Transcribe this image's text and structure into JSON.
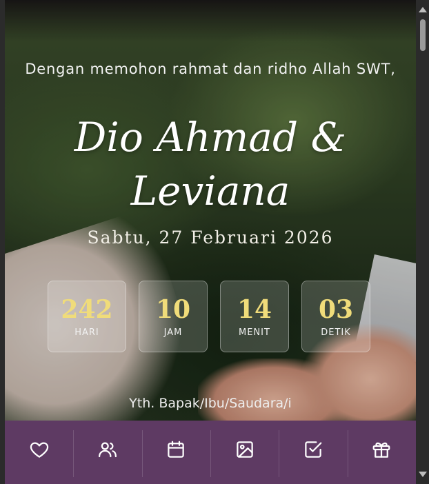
{
  "hero": {
    "intro": "Dengan memohon rahmat dan ridho Allah SWT,",
    "names_line1": "Dio Ahmad &",
    "names_line2": "Leviana",
    "date": "Sabtu, 27 Februari 2026"
  },
  "countdown": [
    {
      "value": "242",
      "unit": "HARI"
    },
    {
      "value": "10",
      "unit": "JAM"
    },
    {
      "value": "14",
      "unit": "MENIT"
    },
    {
      "value": "03",
      "unit": "DETIK"
    }
  ],
  "guest": {
    "greeting": "Yth. Bapak/Ibu/Saudara/i"
  },
  "nav": {
    "items": [
      {
        "icon": "heart-icon"
      },
      {
        "icon": "users-icon"
      },
      {
        "icon": "calendar-icon"
      },
      {
        "icon": "image-icon"
      },
      {
        "icon": "checkbox-icon"
      },
      {
        "icon": "gift-icon"
      }
    ]
  },
  "colors": {
    "accent_gold": "#f0dc7a",
    "navbar_purple": "#5e3a63"
  }
}
